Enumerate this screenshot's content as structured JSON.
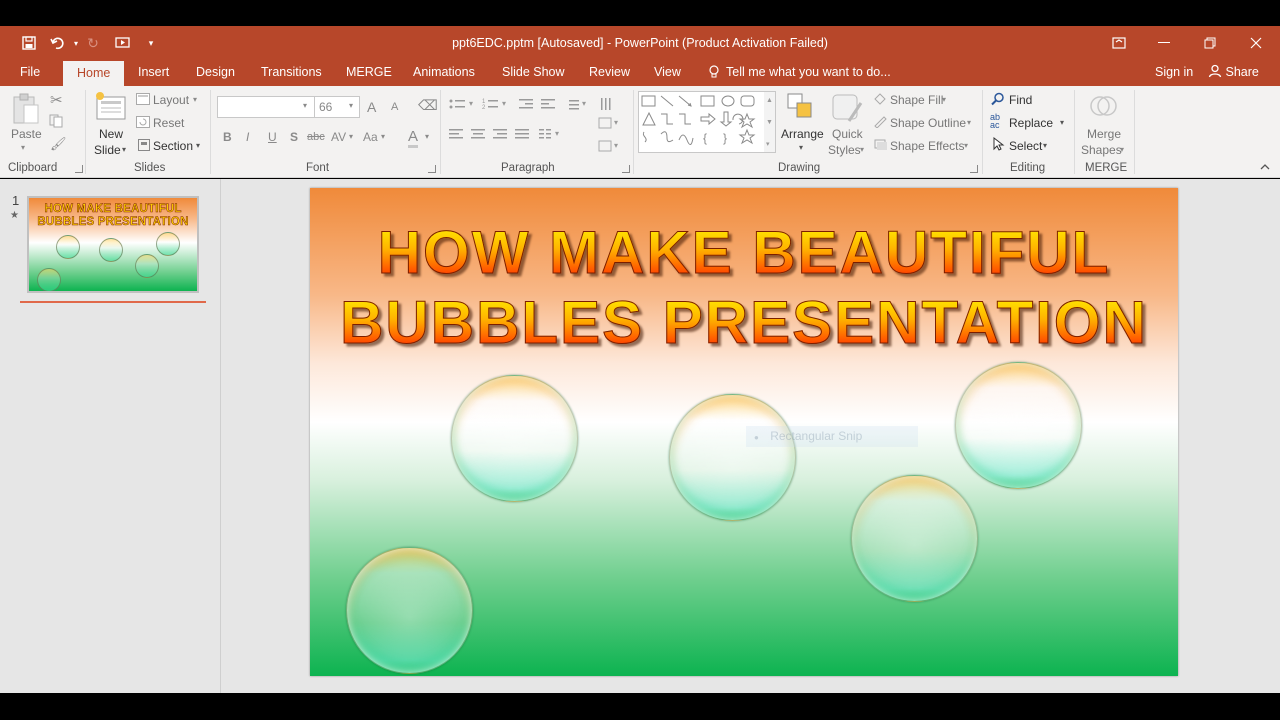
{
  "window": {
    "title": "ppt6EDC.pptm [Autosaved] - PowerPoint (Product Activation Failed)"
  },
  "tabs": [
    "File",
    "Home",
    "Insert",
    "Design",
    "Transitions",
    "MERGE",
    "Animations",
    "Slide Show",
    "Review",
    "View"
  ],
  "tell_me": "Tell me what you want to do...",
  "account": {
    "sign_in": "Sign in",
    "share": "Share"
  },
  "ribbon": {
    "clipboard": {
      "paste": "Paste",
      "label": "Clipboard"
    },
    "slides": {
      "new_slide_1": "New",
      "new_slide_2": "Slide",
      "layout": "Layout",
      "reset": "Reset",
      "section": "Section",
      "label": "Slides"
    },
    "font": {
      "font_name": "",
      "font_size": "66",
      "bold": "B",
      "italic": "I",
      "underline": "U",
      "shadow": "S",
      "strike": "abc",
      "spacing": "AV",
      "case": "Aa",
      "color": "A",
      "grow": "A",
      "shrink": "A",
      "label": "Font"
    },
    "paragraph": {
      "label": "Paragraph"
    },
    "drawing": {
      "arrange": "Arrange",
      "quick_styles_1": "Quick",
      "quick_styles_2": "Styles",
      "shape_fill": "Shape Fill",
      "shape_outline": "Shape Outline",
      "shape_effects": "Shape Effects",
      "label": "Drawing"
    },
    "editing": {
      "find": "Find",
      "replace": "Replace",
      "select": "Select",
      "label": "Editing"
    },
    "merge": {
      "merge_shapes_1": "Merge",
      "merge_shapes_2": "Shapes",
      "label": "MERGE"
    }
  },
  "thumbnails": [
    {
      "number": "1",
      "star": "★",
      "line1": "HOW MAKE BEAUTIFUL",
      "line2": "BUBBLES PRESENTATION"
    }
  ],
  "slide": {
    "title_line1": "HOW MAKE BEAUTIFUL",
    "title_line2": "BUBBLES PRESENTATION",
    "ghost_label": "Rectangular Snip"
  },
  "colors": {
    "accent": "#b7472a",
    "ribbon_bg": "#f3f2f1",
    "workarea_bg": "#e6e6e6"
  }
}
